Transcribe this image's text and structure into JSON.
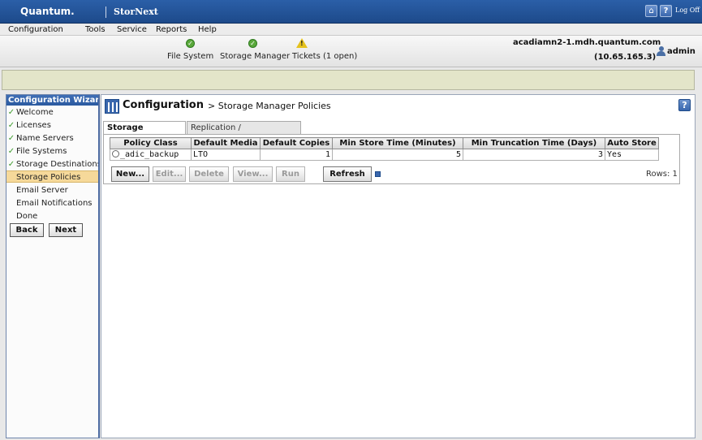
{
  "header": {
    "brand": "Quantum.",
    "product": "StorNext",
    "logoff_label": "Log Off"
  },
  "menu": {
    "items": [
      "Configuration",
      "Tools",
      "Service",
      "Reports",
      "Help"
    ]
  },
  "status": {
    "file_system": "File System",
    "storage_manager": "Storage Manager",
    "tickets": "Tickets (1 open)",
    "hostname": "acadiamn2-1.mdh.quantum.com",
    "ip": "(10.65.165.3)",
    "user": "admin"
  },
  "wizard": {
    "title": "Configuration Wizard",
    "items": [
      {
        "label": "Welcome",
        "done": true
      },
      {
        "label": "Licenses",
        "done": true
      },
      {
        "label": "Name Servers",
        "done": true
      },
      {
        "label": "File Systems",
        "done": true
      },
      {
        "label": "Storage Destinations",
        "done": true
      },
      {
        "label": "Storage Policies",
        "done": false,
        "active": true
      },
      {
        "label": "Email Server",
        "done": false
      },
      {
        "label": "Email Notifications",
        "done": false
      },
      {
        "label": "Done",
        "done": false
      }
    ],
    "back_label": "Back",
    "next_label": "Next"
  },
  "page": {
    "title": "Configuration",
    "breadcrumb": "> Storage Manager Policies",
    "help": "?"
  },
  "tabs": {
    "active": "Storage Manager",
    "inactive": "Replication / Deduplication"
  },
  "table": {
    "columns": [
      "Policy Class",
      "Default Media",
      "Default Copies",
      "Min Store Time (Minutes)",
      "Min Truncation Time (Days)",
      "Auto Store"
    ],
    "rows": [
      [
        "_adic_backup",
        "LTO",
        "1",
        "5",
        "3",
        "Yes"
      ]
    ]
  },
  "buttons": {
    "new": "New...",
    "edit": "Edit...",
    "delete": "Delete",
    "view": "View...",
    "run": "Run",
    "refresh": "Refresh",
    "rows_label": "Rows: 1"
  },
  "colors": {
    "brand_blue": "#2b5fa8",
    "active_wizard_item": "#f6d99a",
    "message_band": "#e3e5c9",
    "ok_green": "#5aa83b",
    "warning_yellow": "#e5c21d"
  },
  "icons": {
    "home": "home-icon",
    "help": "help-icon",
    "ok": "check-circle-icon",
    "warning": "warning-icon",
    "user": "user-icon",
    "config": "configuration-icon"
  }
}
